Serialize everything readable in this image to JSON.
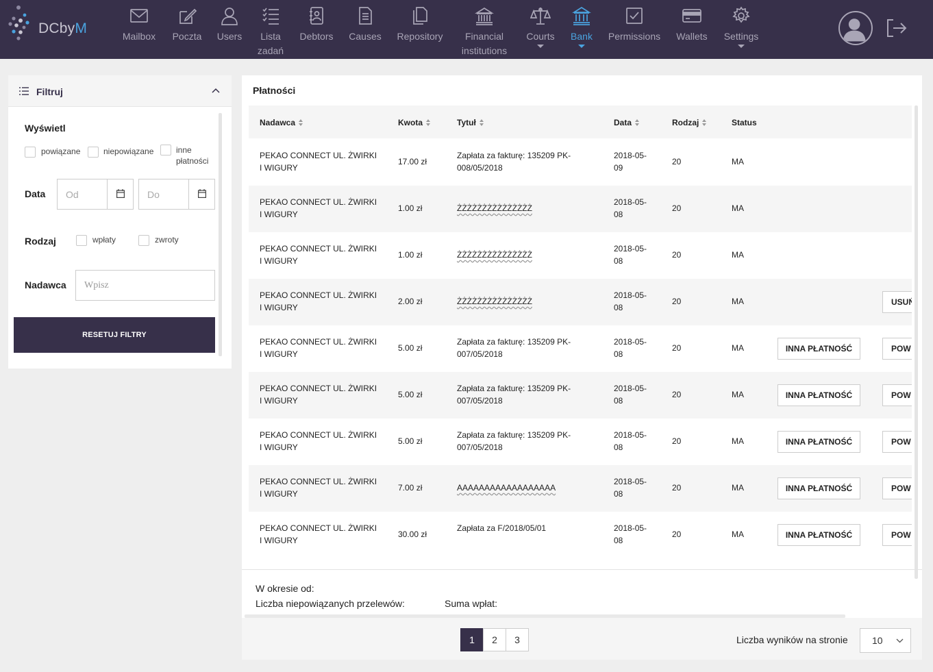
{
  "brand": {
    "name_main": "DCby",
    "name_accent": "M"
  },
  "nav": [
    {
      "label": "Mailbox",
      "icon": "envelope-icon"
    },
    {
      "label": "Poczta",
      "icon": "edit-icon"
    },
    {
      "label": "Users",
      "icon": "user-icon"
    },
    {
      "label": "Lista zadań",
      "icon": "checklist-icon"
    },
    {
      "label": "Debtors",
      "icon": "debtor-icon"
    },
    {
      "label": "Causes",
      "icon": "document-icon"
    },
    {
      "label": "Repository",
      "icon": "files-icon"
    },
    {
      "label": "Financial institutions",
      "icon": "institution-icon"
    },
    {
      "label": "Courts",
      "icon": "scales-icon"
    },
    {
      "label": "Bank",
      "icon": "bank-icon",
      "active": true
    },
    {
      "label": "Permissions",
      "icon": "checkbox-icon"
    },
    {
      "label": "Wallets",
      "icon": "card-icon"
    },
    {
      "label": "Settings",
      "icon": "gear-icon"
    }
  ],
  "filter": {
    "title": "Filtruj",
    "display_label": "Wyświetl",
    "display_options": [
      "powiązane",
      "niepowiązane",
      "inne płatności"
    ],
    "date_label": "Data",
    "date_from_placeholder": "Od",
    "date_to_placeholder": "Do",
    "kind_label": "Rodzaj",
    "kind_options": [
      "wpłaty",
      "zwroty"
    ],
    "sender_label": "Nadawca",
    "sender_placeholder": "Wpisz",
    "reset_button": "RESETUJ FILTRY"
  },
  "payments": {
    "title": "Płatności",
    "columns": [
      "Nadawca",
      "Kwota",
      "Tytuł",
      "Data",
      "Rodzaj",
      "Status"
    ],
    "rows": [
      {
        "sender": "PEKAO CONNECT UL. ŻWIRKI I WIGURY",
        "amount": "17.00 zł",
        "title": "Zapłata za fakturę: 135209 PK-008/05/2018",
        "date": "2018-05-09",
        "kind": "20",
        "status": "MA",
        "actions": []
      },
      {
        "sender": "PEKAO CONNECT UL. ŻWIRKI I WIGURY",
        "amount": "1.00 zł",
        "title": "ŻŻŻŻŻŻŻŻŻŻŻŻŻŻŻ",
        "date": "2018-05-08",
        "kind": "20",
        "status": "MA",
        "actions": []
      },
      {
        "sender": "PEKAO CONNECT UL. ŻWIRKI I WIGURY",
        "amount": "1.00 zł",
        "title": "ŻŻŻŻŻŻŻŻŻŻŻŻŻŻŻ",
        "date": "2018-05-08",
        "kind": "20",
        "status": "MA",
        "actions": []
      },
      {
        "sender": "PEKAO CONNECT UL. ŻWIRKI I WIGURY",
        "amount": "2.00 zł",
        "title": "ŻŻŻŻŻŻŻŻŻŻŻŻŻŻŻ",
        "date": "2018-05-08",
        "kind": "20",
        "status": "MA",
        "actions": [
          "USUŃ"
        ]
      },
      {
        "sender": "PEKAO CONNECT UL. ŻWIRKI I WIGURY",
        "amount": "5.00 zł",
        "title": "Zapłata za fakturę: 135209 PK-007/05/2018",
        "date": "2018-05-08",
        "kind": "20",
        "status": "MA",
        "actions": [
          "INNA PŁATNOŚĆ",
          "POW"
        ]
      },
      {
        "sender": "PEKAO CONNECT UL. ŻWIRKI I WIGURY",
        "amount": "5.00 zł",
        "title": "Zapłata za fakturę: 135209 PK-007/05/2018",
        "date": "2018-05-08",
        "kind": "20",
        "status": "MA",
        "actions": [
          "INNA PŁATNOŚĆ",
          "POW"
        ]
      },
      {
        "sender": "PEKAO CONNECT UL. ŻWIRKI I WIGURY",
        "amount": "5.00 zł",
        "title": "Zapłata za fakturę: 135209 PK-007/05/2018",
        "date": "2018-05-08",
        "kind": "20",
        "status": "MA",
        "actions": [
          "INNA PŁATNOŚĆ",
          "POW"
        ]
      },
      {
        "sender": "PEKAO CONNECT UL. ŻWIRKI I WIGURY",
        "amount": "7.00 zł",
        "title": "AAAAAAAAAAAAAAAAAA",
        "date": "2018-05-08",
        "kind": "20",
        "status": "MA",
        "actions": [
          "INNA PŁATNOŚĆ",
          "POW"
        ]
      },
      {
        "sender": "PEKAO CONNECT UL. ŻWIRKI I WIGURY",
        "amount": "30.00 zł",
        "title": "Zapłata za F/2018/05/01",
        "date": "2018-05-08",
        "kind": "20",
        "status": "MA",
        "actions": [
          "INNA PŁATNOŚĆ",
          "POW"
        ]
      }
    ],
    "summary": {
      "period_label": "W okresie od:",
      "unlinked_label": "Liczba niepowiązanych przelewów:",
      "sum_label": "Suma wpłat:"
    },
    "pagination": {
      "pages": [
        "1",
        "2",
        "3"
      ],
      "current": "1",
      "per_page_label": "Liczba wyników na stronie",
      "per_page_value": "10"
    }
  },
  "colors": {
    "navbar": "#37304a",
    "accent": "#4aa3df",
    "button_dark": "#37304a"
  }
}
